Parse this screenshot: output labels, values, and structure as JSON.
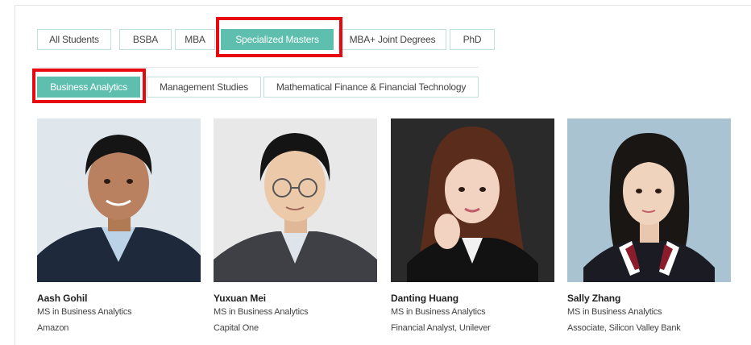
{
  "tabs": [
    {
      "label": "All Students",
      "active": false
    },
    {
      "label": "BSBA",
      "active": false
    },
    {
      "label": "MBA",
      "active": false
    },
    {
      "label": "Specialized Masters",
      "active": true
    },
    {
      "label": "MBA+ Joint Degrees",
      "active": false
    },
    {
      "label": "PhD",
      "active": false
    }
  ],
  "subtabs": [
    {
      "label": "Business Analytics",
      "active": true
    },
    {
      "label": "Management Studies",
      "active": false
    },
    {
      "label": "Mathematical Finance & Financial Technology",
      "active": false
    }
  ],
  "colors": {
    "accent": "#5fbfae",
    "highlight_box": "#e8080f"
  },
  "students": [
    {
      "name": "Aash Gohil",
      "program": "MS in Business Analytics",
      "role": "Amazon"
    },
    {
      "name": "Yuxuan Mei",
      "program": "MS in Business Analytics",
      "role": "Capital One"
    },
    {
      "name": "Danting Huang",
      "program": "MS in Business Analytics",
      "role": "Financial Analyst, Unilever"
    },
    {
      "name": "Sally Zhang",
      "program": "MS in Business Analytics",
      "role": "Associate, Silicon Valley Bank"
    }
  ]
}
